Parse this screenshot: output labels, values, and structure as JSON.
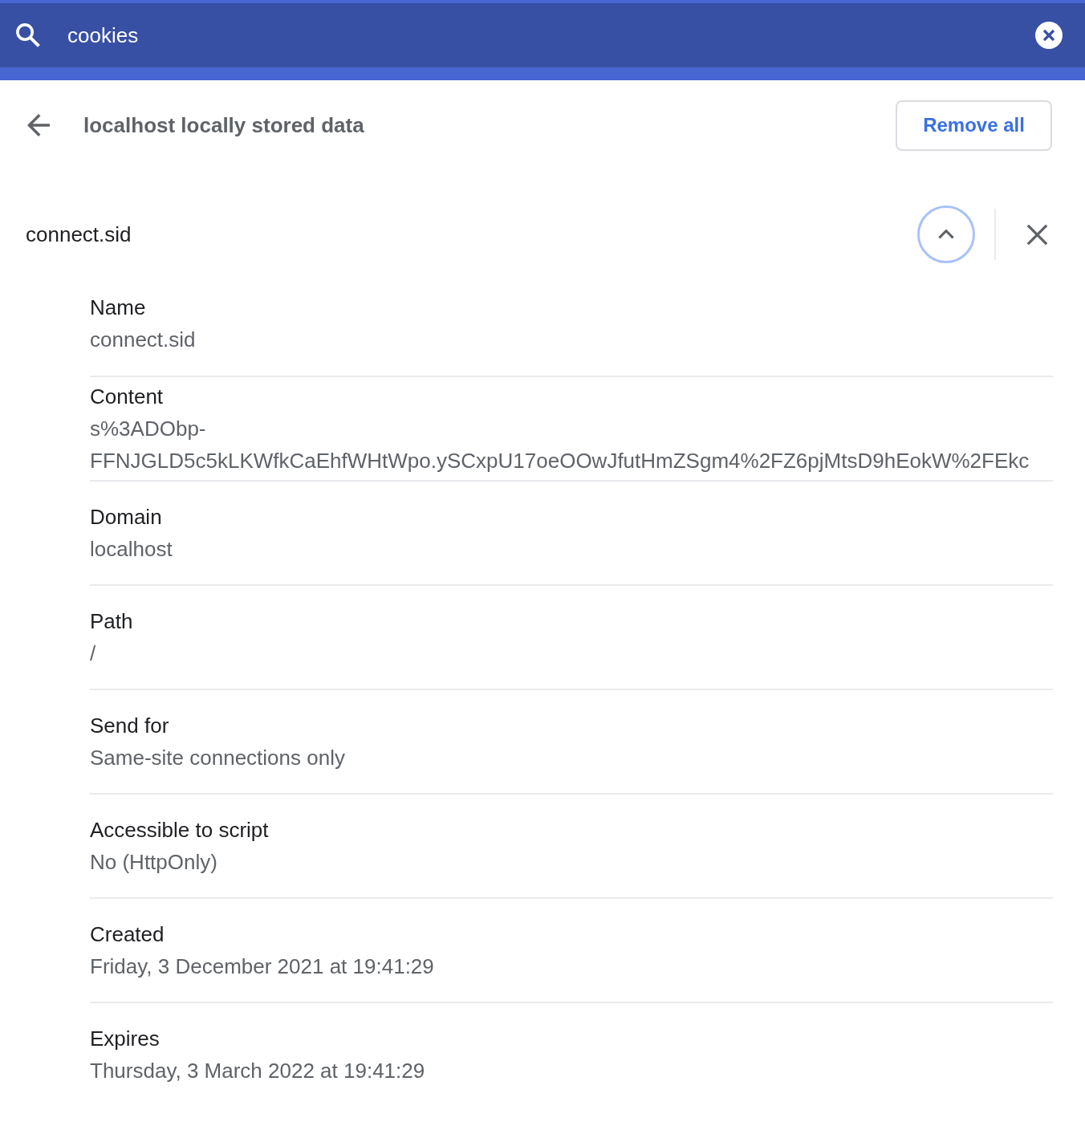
{
  "search": {
    "query": "cookies"
  },
  "header": {
    "title": "localhost locally stored data",
    "action": "Remove all"
  },
  "cookie": {
    "name": "connect.sid",
    "expanded": true,
    "expand_button_focused": true
  },
  "fields": [
    {
      "label": "Name",
      "value": "connect.sid"
    },
    {
      "label": "Content",
      "value": "s%3ADObp-FFNJGLD5c5kLKWfkCaEhfWHtWpo.ySCxpU17oeOOwJfutHmZSgm4%2FZ6pjMtsD9hEokW%2FEkc"
    },
    {
      "label": "Domain",
      "value": "localhost"
    },
    {
      "label": "Path",
      "value": "/"
    },
    {
      "label": "Send for",
      "value": "Same-site connections only"
    },
    {
      "label": "Accessible to script",
      "value": "No (HttpOnly)"
    },
    {
      "label": "Created",
      "value": "Friday, 3 December 2021 at 19:41:29"
    },
    {
      "label": "Expires",
      "value": "Thursday, 3 March 2022 at 19:41:29"
    }
  ]
}
